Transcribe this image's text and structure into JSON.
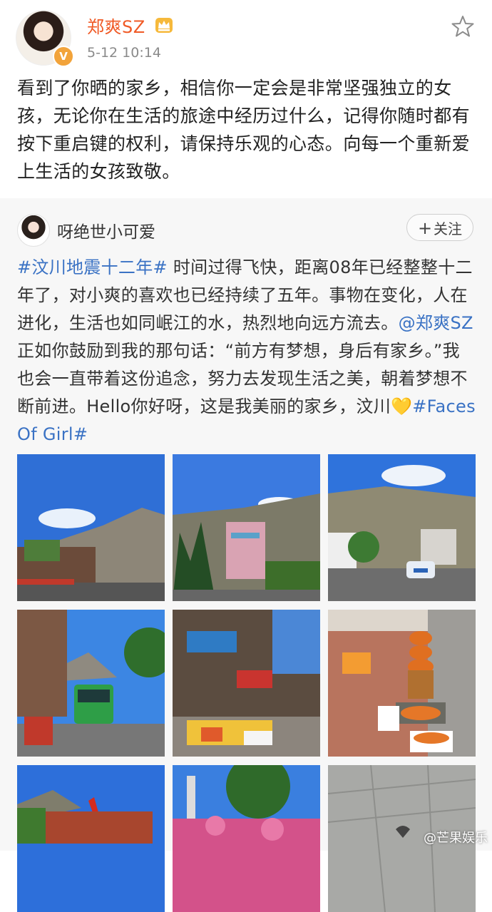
{
  "post": {
    "username": "郑爽SZ",
    "timestamp": "5-12 10:14",
    "text": "看到了你晒的家乡，相信你一定会是非常坚强独立的女孩，无论你在生活的旅途中经历过什么，记得你随时都有按下重启键的权利，请保持乐观的心态。向每一个重新爱上生活的女孩致敬。",
    "verified_badge": "V"
  },
  "repost": {
    "username": "呀绝世小可爱",
    "follow_label": "关注",
    "topic1": "#汶川地震十二年#",
    "text1": " 时间过得飞快，距离08年已经整整十二年了，对小爽的喜欢也已经持续了五年。事物在变化，人在进化，生活也如同岷江的水，热烈地向远方流去。",
    "mention": "@郑爽SZ",
    "text2": " 正如你鼓励到我的那句话：“前方有梦想，身后有家乡。”我也会一直带着这份追念，努力去发现生活之美，朝着梦想不断前进。Hello你好呀，这是我美丽的家乡，汶川",
    "heart": "💛",
    "topic2": "#Faces Of Girl#"
  },
  "photos": [
    {
      "name": "photo-street-mountain"
    },
    {
      "name": "photo-building-trees"
    },
    {
      "name": "photo-road-car"
    },
    {
      "name": "photo-street-bus"
    },
    {
      "name": "photo-market-street"
    },
    {
      "name": "photo-fruit-stall"
    },
    {
      "name": "photo-red-flag-building"
    },
    {
      "name": "photo-flowers-tower"
    },
    {
      "name": "photo-pavement"
    }
  ],
  "watermark": "@芒果娱乐",
  "colors": {
    "username": "#f05a26",
    "link": "#3a72c4",
    "repost_bg": "#f7f7f7"
  },
  "icons": [
    "crown-icon",
    "star-icon",
    "verified-icon",
    "plus-icon"
  ]
}
